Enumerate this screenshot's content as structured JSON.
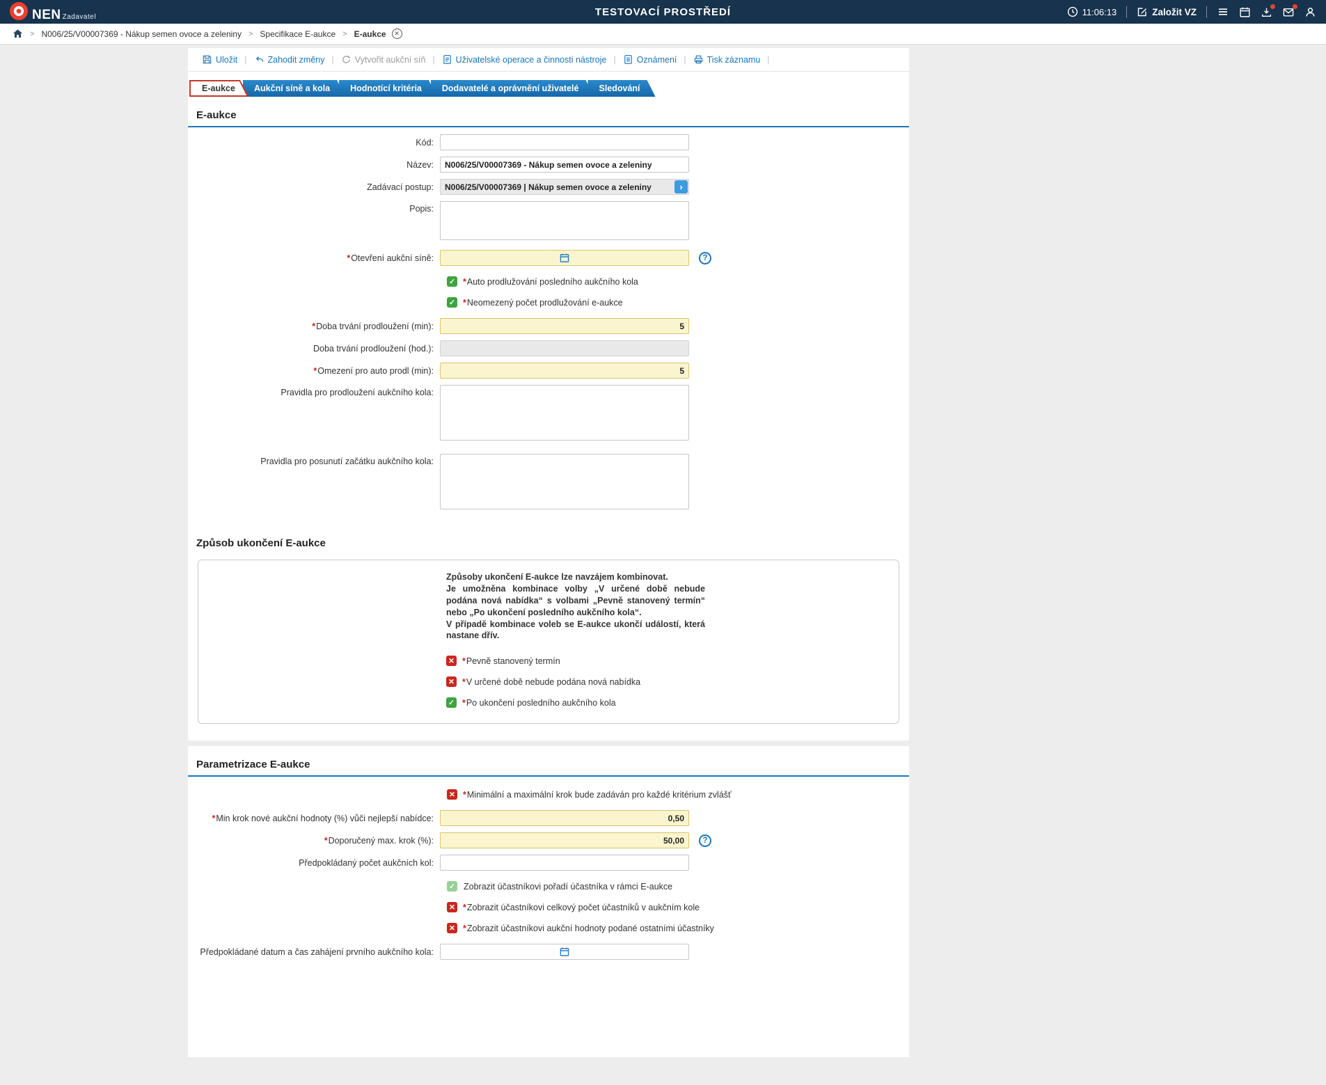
{
  "colors": {
    "header_bg": "#17334d",
    "accent_blue": "#1b75bb",
    "active_tab_red": "#c0392b",
    "checkbox_green": "#3fa33f",
    "checkbox_red": "#c8281e",
    "required_red": "#cc2222",
    "yellow_field": "#fbf5cf"
  },
  "header": {
    "logo": "NEN",
    "logo_sub": "Zadavatel",
    "env_title": "TESTOVACÍ PROSTŘEDÍ",
    "time": "11:06:13",
    "create_vz": "Založit VZ"
  },
  "breadcrumb": {
    "items": [
      "N006/25/V00007369 - Nákup semen ovoce a zeleniny",
      "Specifikace E-aukce",
      "E-aukce"
    ]
  },
  "toolbar": {
    "items": [
      {
        "label": "Uložit"
      },
      {
        "label": "Zahodit změny"
      },
      {
        "label": "Vytvořit aukční síň",
        "disabled": true
      },
      {
        "label": "Uživatelské operace a činnosti nástroje"
      },
      {
        "label": "Oznámení"
      },
      {
        "label": "Tisk záznamu"
      }
    ]
  },
  "tabs": [
    {
      "label": "E-aukce",
      "active": true
    },
    {
      "label": "Aukční síně a kola"
    },
    {
      "label": "Hodnotící kritéria"
    },
    {
      "label": "Dodavatelé a oprávnění uživatelé"
    },
    {
      "label": "Sledování"
    }
  ],
  "section_eaukce": {
    "title": "E-aukce",
    "fields": {
      "kod": {
        "label": "Kód:",
        "value": ""
      },
      "nazev": {
        "label": "Název:",
        "value": "N006/25/V00007369 - Nákup semen ovoce a zeleniny"
      },
      "zadavaci_postup": {
        "label": "Zadávací postup:",
        "value": "N006/25/V00007369 | Nákup semen ovoce a zeleniny"
      },
      "popis": {
        "label": "Popis:",
        "value": ""
      },
      "otevreni_aukcni_sine": {
        "req": "*",
        "label": "Otevření aukční síně:",
        "value": ""
      },
      "auto_prodluzovani": {
        "req": "*",
        "label": "Auto prodlužování posledního aukčního kola",
        "state": "checked"
      },
      "neomezeny_pocet": {
        "req": "*",
        "label": "Neomezený počet prodlužování e-aukce",
        "state": "checked"
      },
      "doba_trvani_min": {
        "req": "*",
        "label": "Doba trvání prodloužení (min):",
        "value": "5"
      },
      "doba_trvani_hod": {
        "label": "Doba trvání prodloužení (hod.):",
        "value": ""
      },
      "omezeni_auto_prodl": {
        "req": "*",
        "label": "Omezení pro auto prodl (min):",
        "value": "5"
      },
      "pravidla_prodlouzeni": {
        "label": "Pravidla pro prodloužení aukčního kola:",
        "value": ""
      },
      "pravidla_posunuti": {
        "label": "Pravidla pro posunutí začátku aukčního kola:",
        "value": ""
      }
    }
  },
  "section_ukonceni": {
    "title": "Způsob ukončení E-aukce",
    "intro_lines": [
      "Způsoby ukončení E-aukce lze navzájem kombinovat.",
      "Je umožněna kombinace volby „V určené době nebude podána nová nabídka“ s volbami „Pevně stanovený termín“ nebo „Po ukončení posledního aukčního kola“.",
      "V případě kombinace voleb se E-aukce ukončí událostí, která nastane dřív."
    ],
    "checks": [
      {
        "req": "*",
        "label": "Pevně stanovený termín",
        "state": "unchecked"
      },
      {
        "req": "*",
        "label": "V určené době nebude podána nová nabídka",
        "state": "unchecked"
      },
      {
        "req": "*",
        "label": "Po ukončení posledního aukčního kola",
        "state": "checked"
      }
    ]
  },
  "section_parametrizace": {
    "title": "Parametrizace E-aukce",
    "fields": {
      "krok_kazde_kriterium": {
        "req": "*",
        "label": "Minimální a maximální krok bude zadáván pro každé kritérium zvlášť",
        "state": "unchecked"
      },
      "min_krok": {
        "req": "*",
        "label": "Min krok nové aukční hodnoty (%) vůči nejlepší nabídce:",
        "value": "0,50"
      },
      "doporuceny_max_krok": {
        "req": "*",
        "label": "Doporučený max. krok (%):",
        "value": "50,00"
      },
      "pocet_aukcnich_kol": {
        "label": "Předpokládaný počet aukčních kol:",
        "value": ""
      },
      "zobrazit_poradi": {
        "label": "Zobrazit účastníkovi pořadí účastníka v rámci E-aukce",
        "state": "checked_ro"
      },
      "zobrazit_pocet": {
        "req": "*",
        "label": "Zobrazit účastníkovi celkový počet účastníků v aukčním kole",
        "state": "unchecked"
      },
      "zobrazit_hodnoty": {
        "req": "*",
        "label": "Zobrazit účastníkovi aukční hodnoty podané ostatními účastníky",
        "state": "unchecked"
      },
      "datum_zahajeni": {
        "label": "Předpokládané datum a čas zahájení prvního aukčního kola:",
        "value": ""
      }
    }
  }
}
